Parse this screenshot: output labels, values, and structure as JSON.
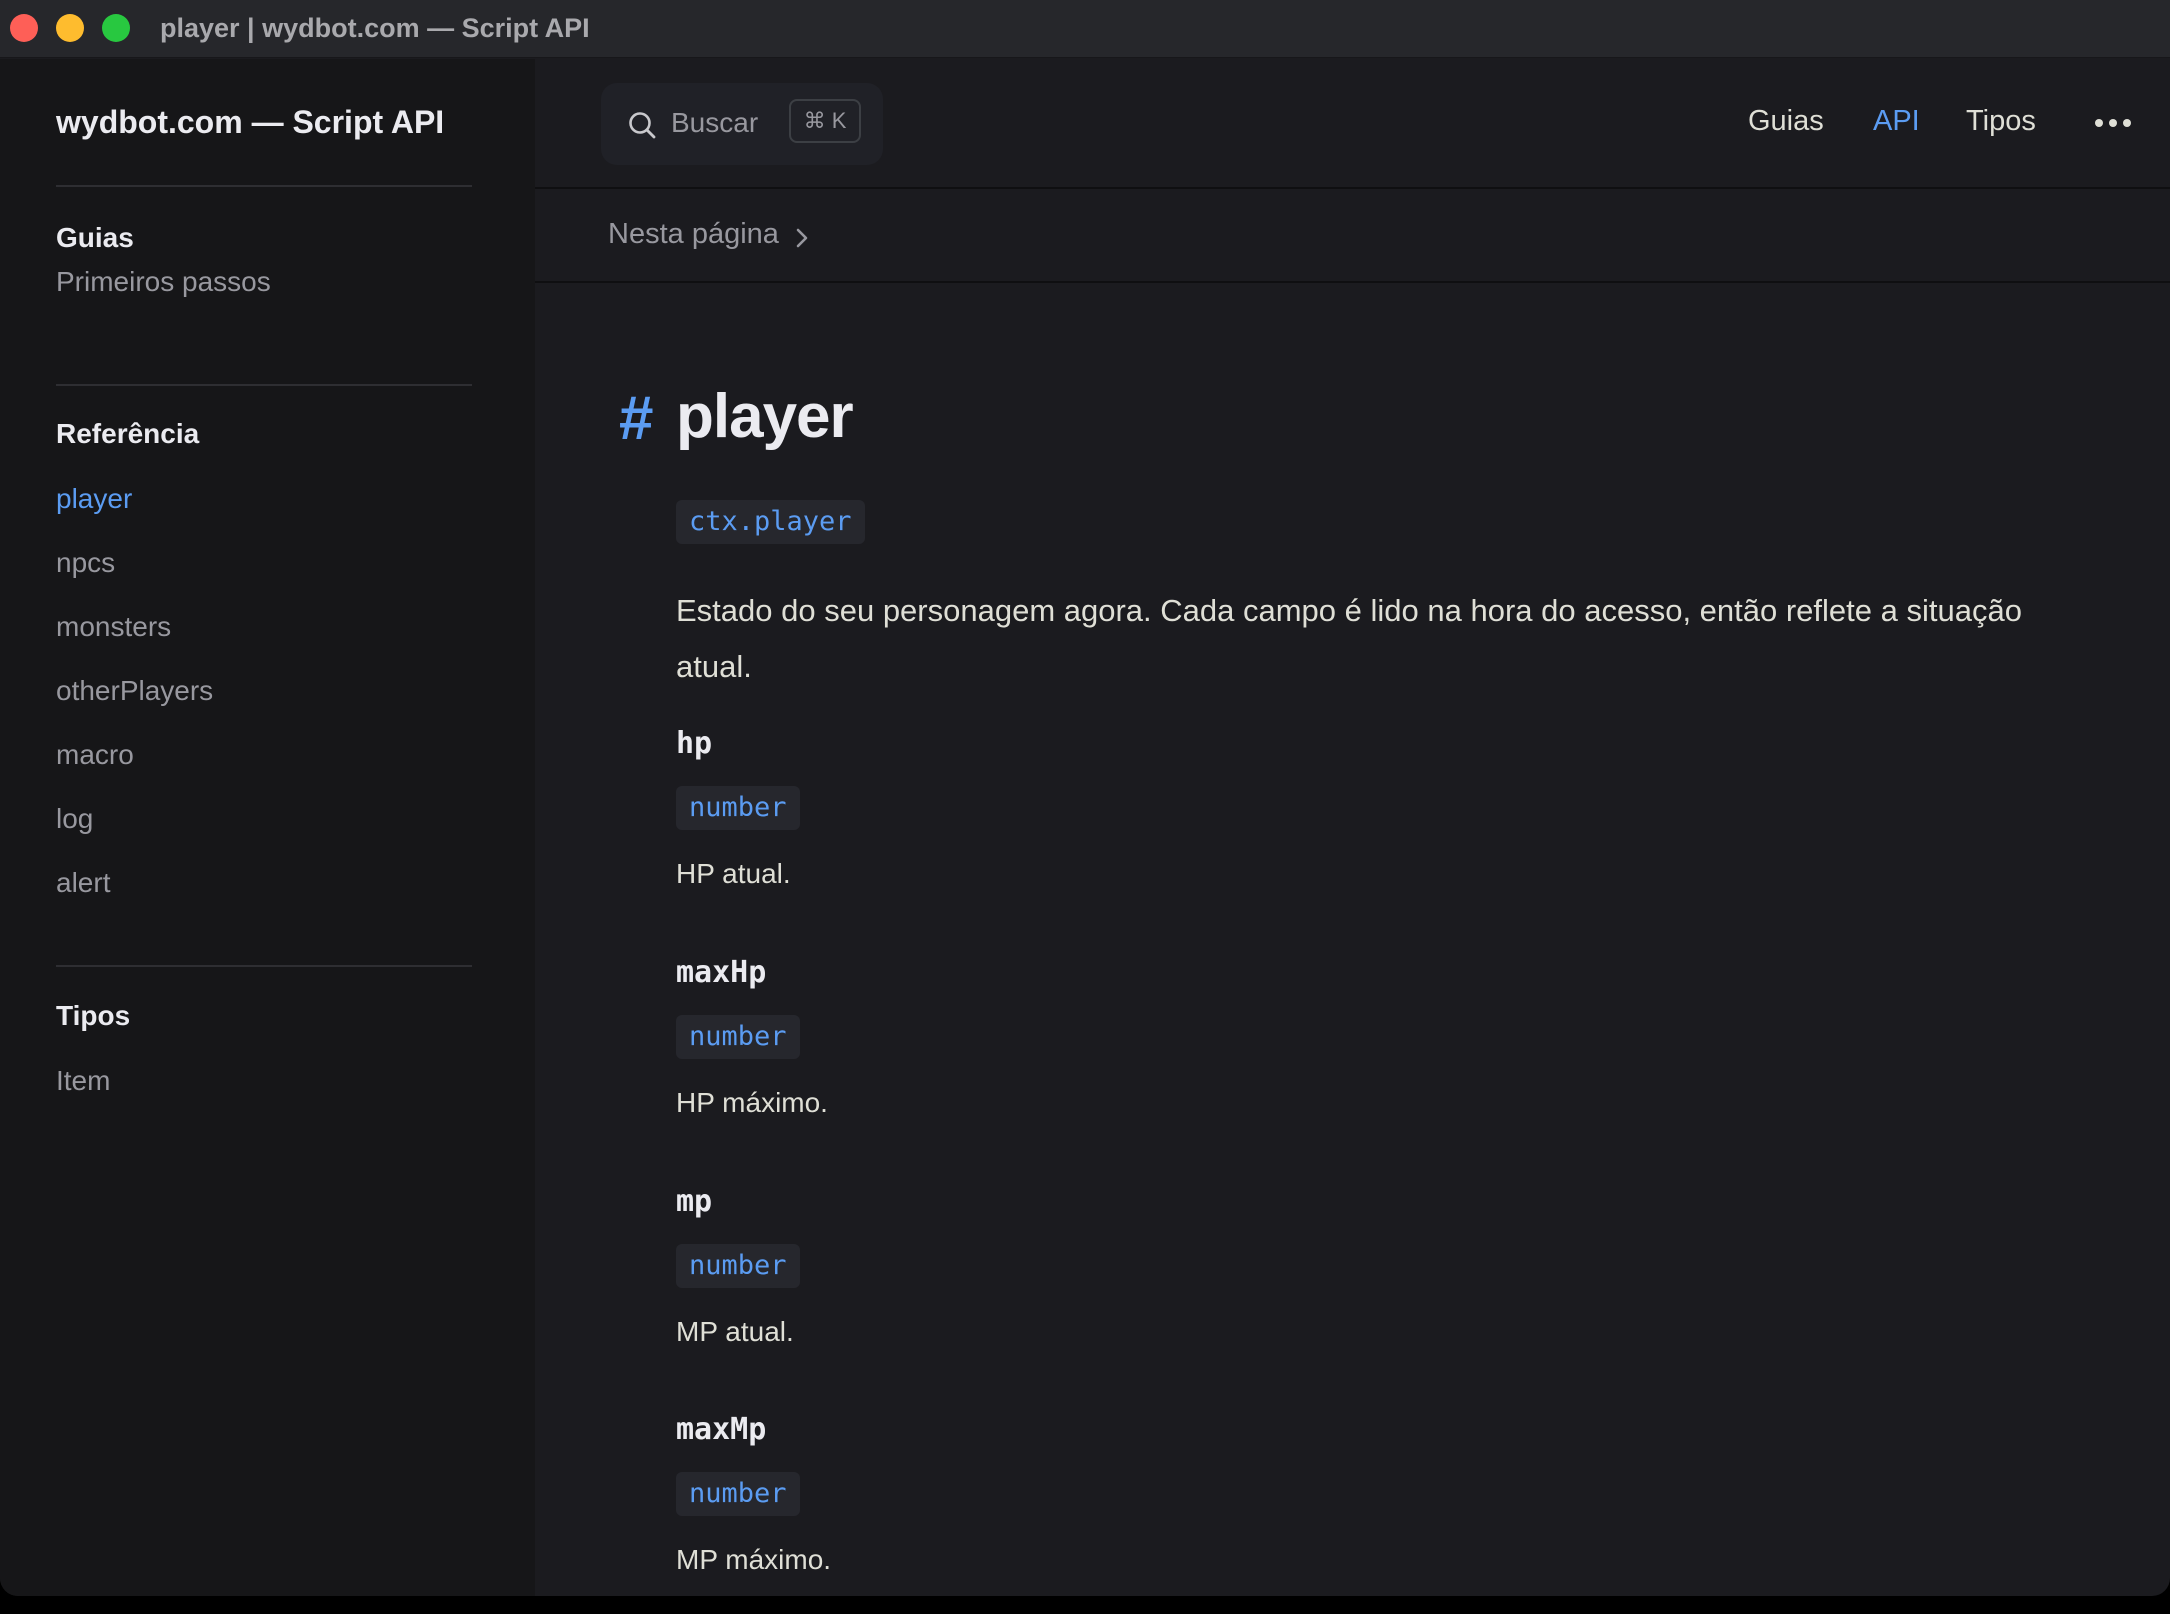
{
  "window": {
    "title": "player | wydbot.com — Script API"
  },
  "sidebar": {
    "site_title": "wydbot.com — Script API",
    "groups": [
      {
        "title": "Guias",
        "items": [
          {
            "label": "Primeiros passos"
          }
        ]
      },
      {
        "title": "Referência",
        "items": [
          {
            "label": "player",
            "active": true
          },
          {
            "label": "npcs"
          },
          {
            "label": "monsters"
          },
          {
            "label": "otherPlayers"
          },
          {
            "label": "macro"
          },
          {
            "label": "log"
          },
          {
            "label": "alert"
          }
        ]
      },
      {
        "title": "Tipos",
        "items": [
          {
            "label": "Item"
          }
        ]
      }
    ]
  },
  "topnav": {
    "search": {
      "label": "Buscar",
      "shortcut": "⌘ K"
    },
    "links": [
      {
        "label": "Guias"
      },
      {
        "label": "API",
        "active": true
      },
      {
        "label": "Tipos"
      }
    ]
  },
  "localnav": {
    "label": "Nesta página"
  },
  "page": {
    "title": "player",
    "hash": "#",
    "signature": "ctx.player",
    "intro": "Estado do seu personagem agora. Cada campo é lido na hora do acesso, então reflete a situação atual.",
    "properties": [
      {
        "name": "hp",
        "type": "number",
        "desc": "HP atual."
      },
      {
        "name": "maxHp",
        "type": "number",
        "desc": "HP máximo."
      },
      {
        "name": "mp",
        "type": "number",
        "desc": "MP atual."
      },
      {
        "name": "maxMp",
        "type": "number",
        "desc": "MP máximo."
      }
    ]
  },
  "colors": {
    "accent": "#5b9cf2",
    "background": "#1b1b1f",
    "sidebar": "#161618"
  },
  "icons": {
    "search": "search-icon",
    "more": "more-icon",
    "chevron": "chevron-right-icon"
  }
}
